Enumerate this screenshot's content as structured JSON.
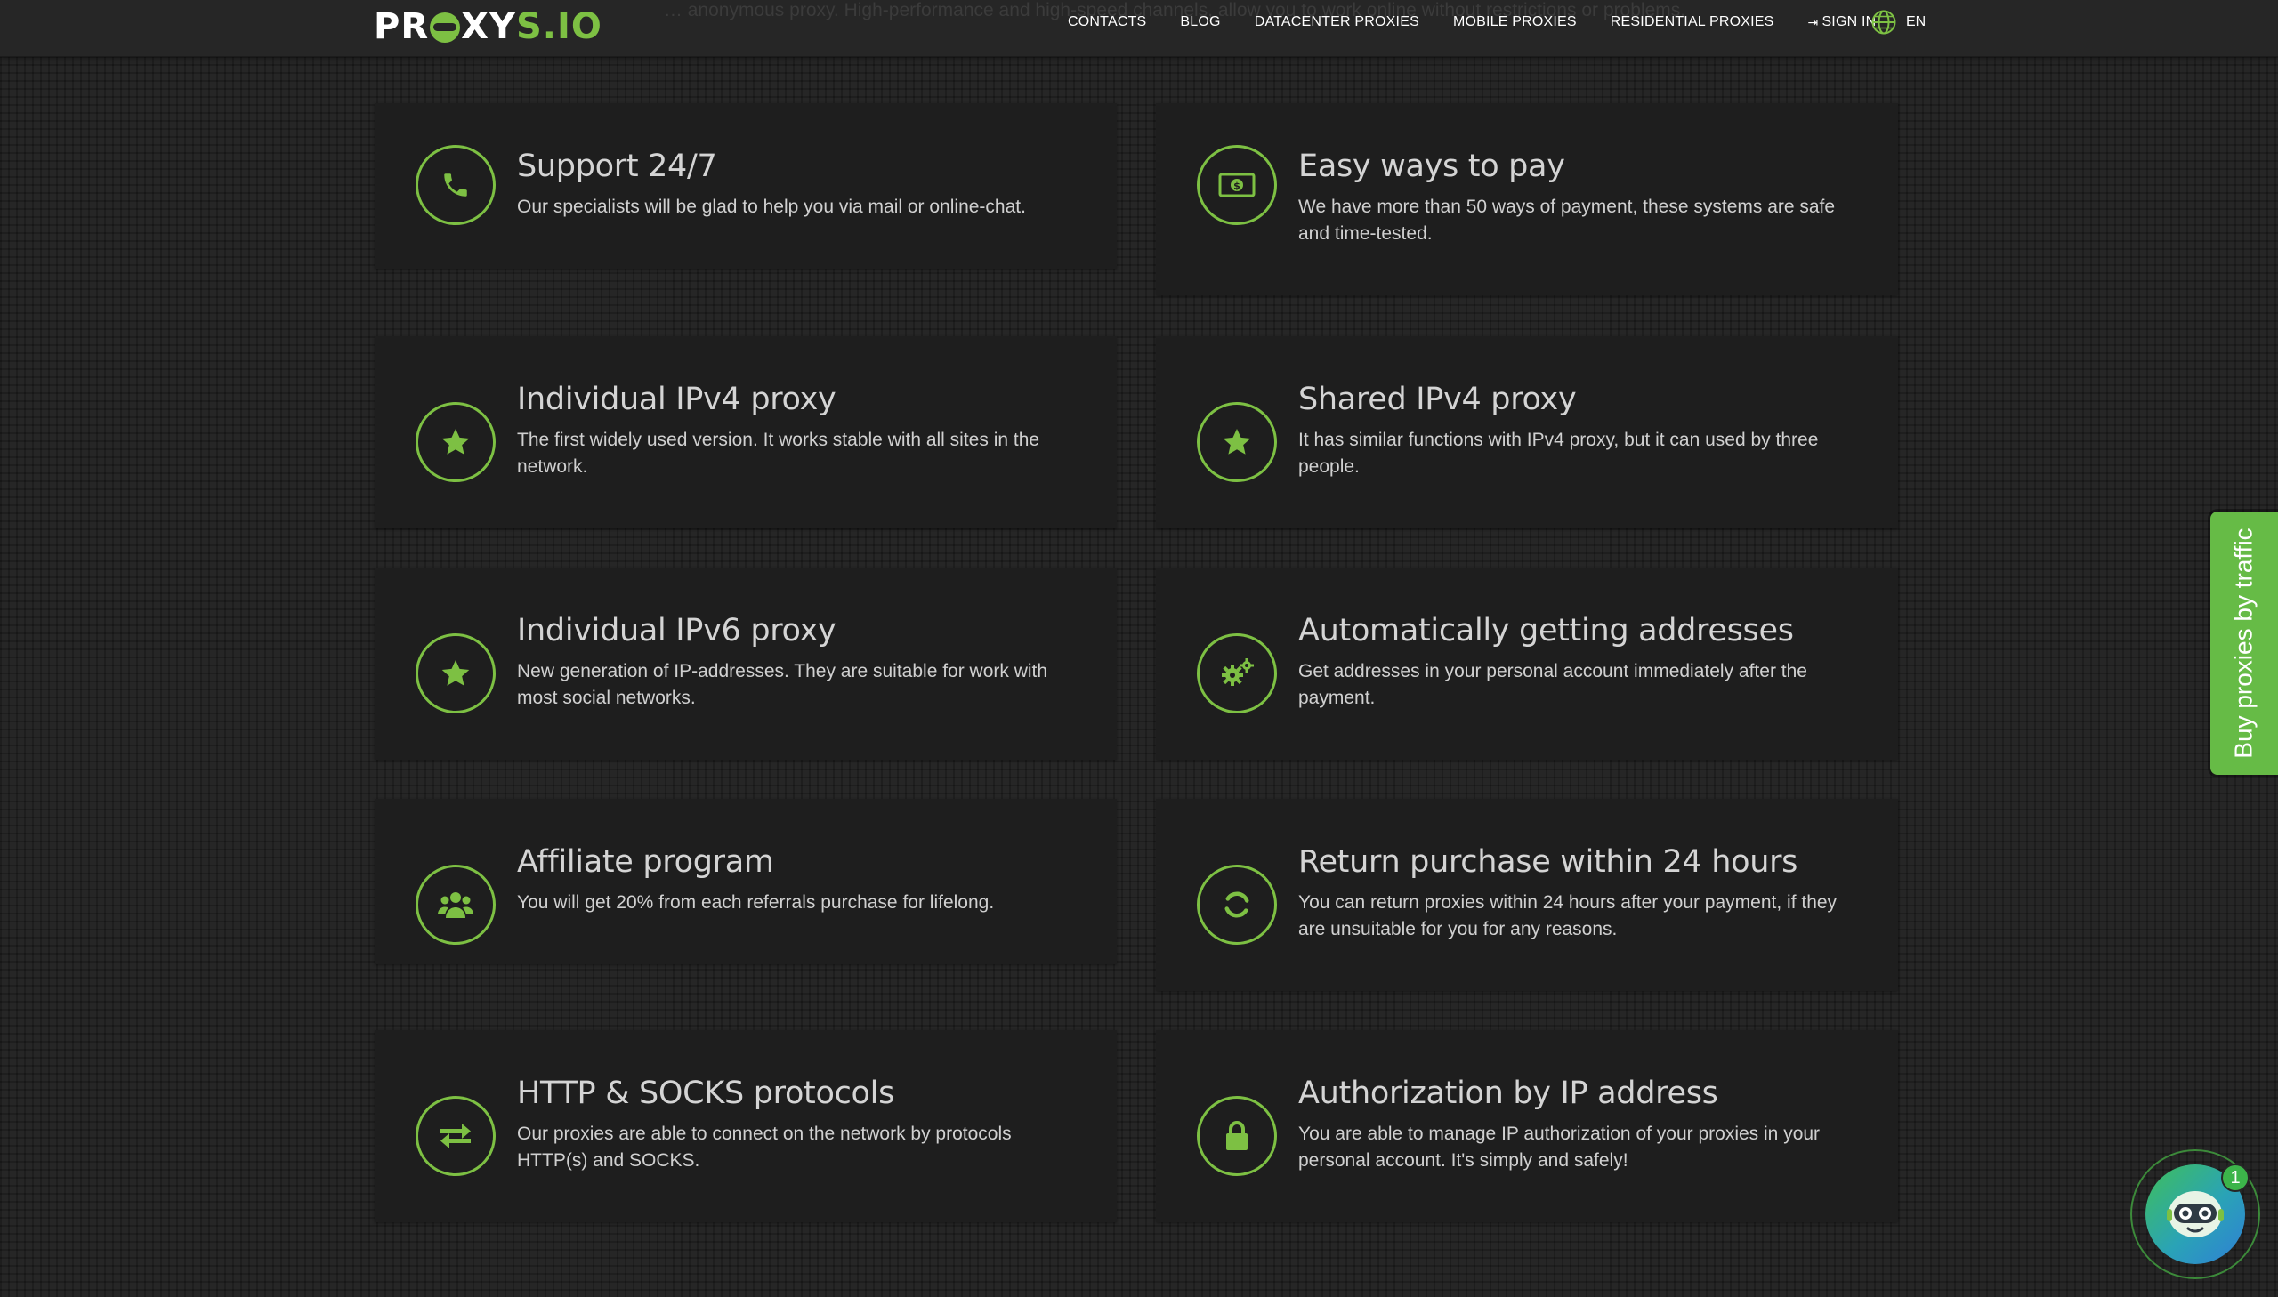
{
  "header": {
    "ghost_text": "… anonymous proxy. High-performance and high-speed channels, allow you to work online without restrictions or problems.",
    "logo": {
      "part1": "PR",
      "part2": "XY",
      "part3": "S.IO"
    },
    "nav": [
      {
        "label": "CONTACTS"
      },
      {
        "label": "BLOG"
      },
      {
        "label": "DATACENTER PROXIES"
      },
      {
        "label": "MOBILE PROXIES"
      },
      {
        "label": "RESIDENTIAL PROXIES"
      },
      {
        "label": "SIGN IN"
      }
    ],
    "language": "EN"
  },
  "features": [
    {
      "title": "Support 24/7",
      "desc": "Our specialists will be glad to help you via mail or online-chat.",
      "icon": "phone-icon"
    },
    {
      "title": "Easy ways to pay",
      "desc": "We have more than 50 ways of payment, these systems are safe and time-tested.",
      "icon": "money-icon"
    },
    {
      "title": "Individual IPv4 proxy",
      "desc": "The first widely used version. It works stable with all sites in the network.",
      "icon": "star-icon"
    },
    {
      "title": "Shared IPv4 proxy",
      "desc": "It has similar functions with IPv4 proxy, but it can used by three people.",
      "icon": "star-icon"
    },
    {
      "title": "Individual IPv6 proxy",
      "desc": "New generation of IP-addresses. They are suitable for work with most social networks.",
      "icon": "star-icon"
    },
    {
      "title": "Automatically getting addresses",
      "desc": "Get addresses in your personal account immediately after the payment.",
      "icon": "gears-icon"
    },
    {
      "title": "Affiliate program",
      "desc": "You will get 20% from each referrals purchase for lifelong.",
      "icon": "users-icon"
    },
    {
      "title": "Return purchase within 24 hours",
      "desc": "You can return proxies within 24 hours after your payment, if they are unsuitable for you for any reasons.",
      "icon": "refresh-icon"
    },
    {
      "title": "HTTP & SOCKS protocols",
      "desc": "Our proxies are able to connect on the network by protocols HTTP(s) and SOCKS.",
      "icon": "exchange-icon"
    },
    {
      "title": "Authorization by IP address",
      "desc": "You are able to manage IP authorization of your proxies in your personal account. It's simply and safely!",
      "icon": "lock-icon"
    }
  ],
  "side_tab": {
    "label": "Buy proxies by traffic"
  },
  "chat": {
    "badge": "1"
  },
  "colors": {
    "accent": "#7dc043",
    "card_bg": "#1e1e1e",
    "page_bg": "#262626",
    "tab_bg": "#66bb46"
  }
}
